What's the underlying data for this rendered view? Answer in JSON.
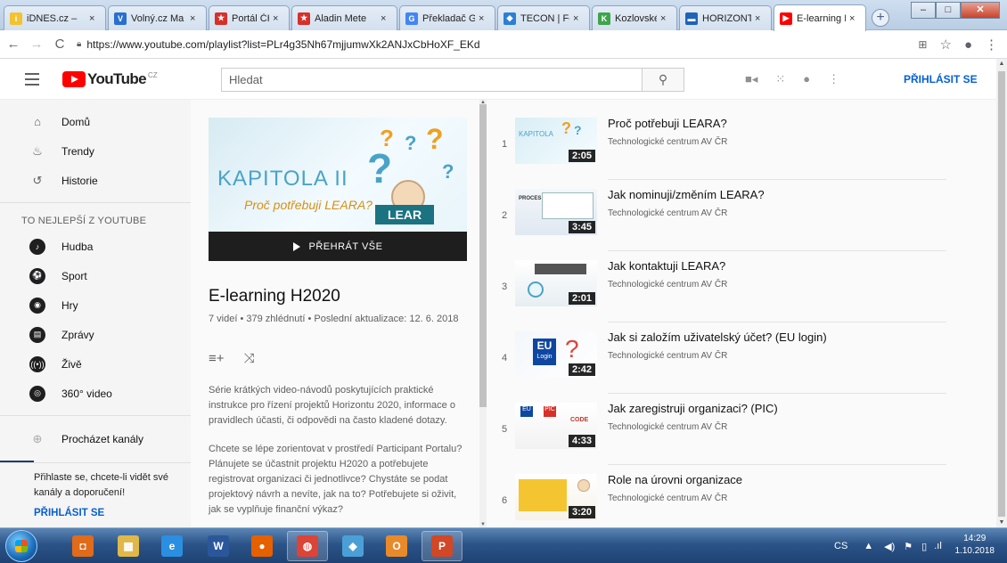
{
  "browser": {
    "tabs": [
      {
        "label": "iDNES.cz – ",
        "favicon_color": "#f2c230",
        "glyph": "i"
      },
      {
        "label": "Volný.cz Ma",
        "favicon_color": "#2a6fd0",
        "glyph": "V"
      },
      {
        "label": "Portál ČHMÚ",
        "favicon_color": "#d6302a",
        "glyph": "★"
      },
      {
        "label": "Aladin Mete",
        "favicon_color": "#d6302a",
        "glyph": "★"
      },
      {
        "label": "Překladač G",
        "favicon_color": "#4285f4",
        "glyph": "G"
      },
      {
        "label": "TECON | For",
        "favicon_color": "#2b7fd6",
        "glyph": "◆"
      },
      {
        "label": "Kozlovské sl",
        "favicon_color": "#3fa34d",
        "glyph": "K"
      },
      {
        "label": "HORIZONT",
        "favicon_color": "#1f63b8",
        "glyph": "▬"
      },
      {
        "label": "E-learning H",
        "favicon_color": "#ff0000",
        "glyph": "▶",
        "active": true
      }
    ],
    "new_tab": "+",
    "url": "https://www.youtube.com/playlist?list=PLr4g35Nh67mjjumwXk2ANJxCbHoXF_EKd"
  },
  "header": {
    "logo_text": "YouTube",
    "logo_region": "CZ",
    "search_placeholder": "Hledat",
    "signin": "PŘIHLÁSIT SE"
  },
  "sidebar": {
    "items": [
      {
        "label": "Domů",
        "icon": "home-icon",
        "glyph": "⌂"
      },
      {
        "label": "Trendy",
        "icon": "flame-icon",
        "glyph": "♨"
      },
      {
        "label": "Historie",
        "icon": "history-icon",
        "glyph": "↺"
      }
    ],
    "best_heading": "TO NEJLEPŠÍ Z YOUTUBE",
    "best_items": [
      {
        "label": "Hudba",
        "icon": "music-icon",
        "glyph": "♪"
      },
      {
        "label": "Sport",
        "icon": "sport-icon",
        "glyph": "⚽"
      },
      {
        "label": "Hry",
        "icon": "gamepad-icon",
        "glyph": "◉"
      },
      {
        "label": "Zprávy",
        "icon": "news-icon",
        "glyph": "▤"
      },
      {
        "label": "Živě",
        "icon": "live-icon",
        "glyph": "((•))"
      },
      {
        "label": "360° video",
        "icon": "360-icon",
        "glyph": "◎"
      }
    ],
    "browse_channels": "Procházet kanály",
    "signin_prompt": "Přihlaste se, chcete-li vidět své kanály a doporučení!",
    "signin_link": "PŘIHLÁSIT SE"
  },
  "playlist": {
    "thumb_title": "KAPITOLA II",
    "thumb_subtitle": "Proč potřebuji LEARA?",
    "thumb_badge": "LEAR",
    "play_all": "PŘEHRÁT VŠE",
    "title": "E-learning H2020",
    "meta": "7 videí • 379 zhlédnutí • Poslední aktualizace: 12. 6. 2018",
    "description_1": "Série krátkých video-návodů poskytujících praktické instrukce pro řízení projektů Horizontu 2020, informace o pravidlech účasti, či odpovědi na často kladené dotazy.",
    "description_2": "Chcete se lépe zorientovat v prostředí Participant Portalu? Plánujete se účastnit projektu H2020 a potřebujete registrovat organizaci či jednotlivce? Chystáte se podat projektový návrh a nevíte, jak na to? Potřebujete si oživit, jak se vyplňuje finanční výkaz?"
  },
  "videos": [
    {
      "index": "1",
      "title": "Proč potřebuji LEARA?",
      "channel": "Technologické centrum AV ČR",
      "duration": "2:05"
    },
    {
      "index": "2",
      "title": "Jak nominuji/změním LEARA?",
      "channel": "Technologické centrum AV ČR",
      "duration": "3:45"
    },
    {
      "index": "3",
      "title": "Jak kontaktuji LEARA?",
      "channel": "Technologické centrum AV ČR",
      "duration": "2:01"
    },
    {
      "index": "4",
      "title": "Jak si založím uživatelský účet? (EU login)",
      "channel": "Technologické centrum AV ČR",
      "duration": "2:42"
    },
    {
      "index": "5",
      "title": "Jak zaregistruji organizaci? (PIC)",
      "channel": "Technologické centrum AV ČR",
      "duration": "4:33"
    },
    {
      "index": "6",
      "title": "Role na úrovni organizace",
      "channel": "Technologické centrum AV ČR",
      "duration": "3:20"
    }
  ],
  "thumb_captions": {
    "v1": "KAPITOLA",
    "v2": "PROCES",
    "v4_eu": "EU",
    "v4_login": "Login",
    "v5_eu": "EU",
    "v5_pic": "PIC",
    "v5_code": "CODE"
  },
  "taskbar": {
    "apps": [
      {
        "name": "outlook-app-icon",
        "color": "#e06b1a",
        "glyph": "◘"
      },
      {
        "name": "explorer-app-icon",
        "color": "#e0b84a",
        "glyph": "▦"
      },
      {
        "name": "ie-app-icon",
        "color": "#2a8fe0",
        "glyph": "e"
      },
      {
        "name": "word-app-icon",
        "color": "#2b579a",
        "glyph": "W"
      },
      {
        "name": "firefox-app-icon",
        "color": "#e66000",
        "glyph": "●"
      },
      {
        "name": "chrome-app-icon",
        "color": "#db4437",
        "glyph": "◍"
      },
      {
        "name": "photos-app-icon",
        "color": "#4aa0d6",
        "glyph": "◆"
      },
      {
        "name": "notes-app-icon",
        "color": "#e88a2a",
        "glyph": "O"
      },
      {
        "name": "powerpoint-app-icon",
        "color": "#d24726",
        "glyph": "P"
      }
    ],
    "language": "CS",
    "time": "14:29",
    "date": "1.10.2018"
  }
}
